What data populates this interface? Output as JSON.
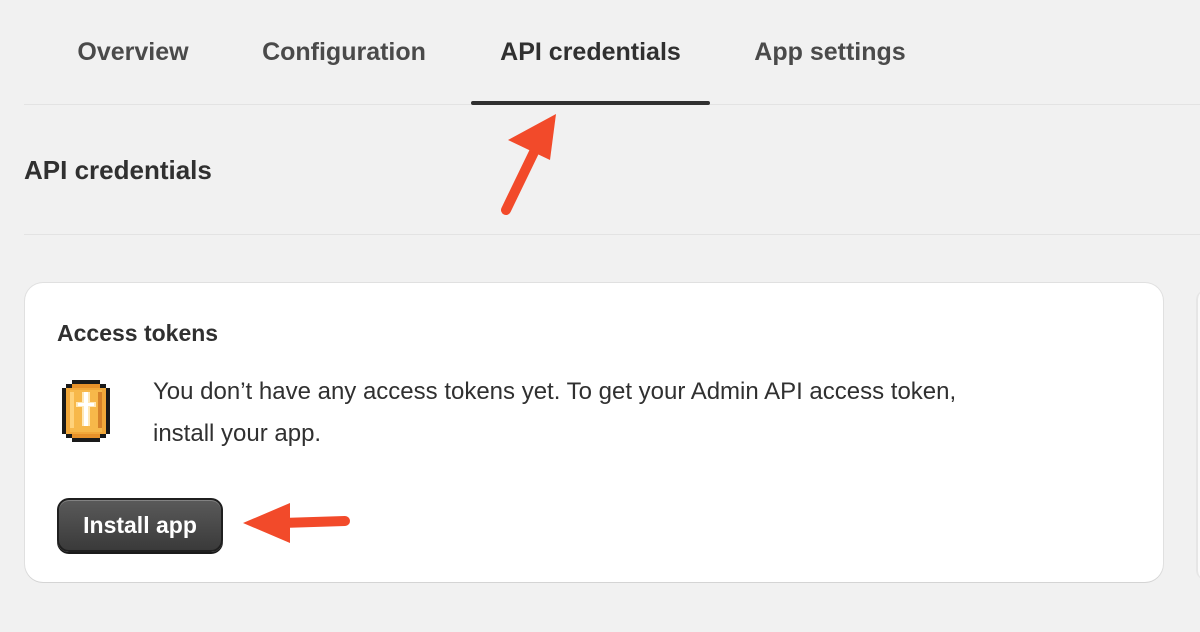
{
  "tabs": [
    {
      "label": "Overview",
      "active": false
    },
    {
      "label": "Configuration",
      "active": false
    },
    {
      "label": "API credentials",
      "active": true
    },
    {
      "label": "App settings",
      "active": false
    }
  ],
  "section": {
    "title": "API credentials"
  },
  "card": {
    "title": "Access tokens",
    "icon": "coin-icon",
    "message_line1": "You don’t have any access tokens yet. To get your Admin API access token,",
    "message_line2": "install your app.",
    "install_button_label": "Install app"
  },
  "colors": {
    "background": "#f1f1f1",
    "card": "#ffffff",
    "primary_button": "#3f3f3f",
    "annotation_arrow": "#f24a2a",
    "coin": "#f2a83a"
  }
}
